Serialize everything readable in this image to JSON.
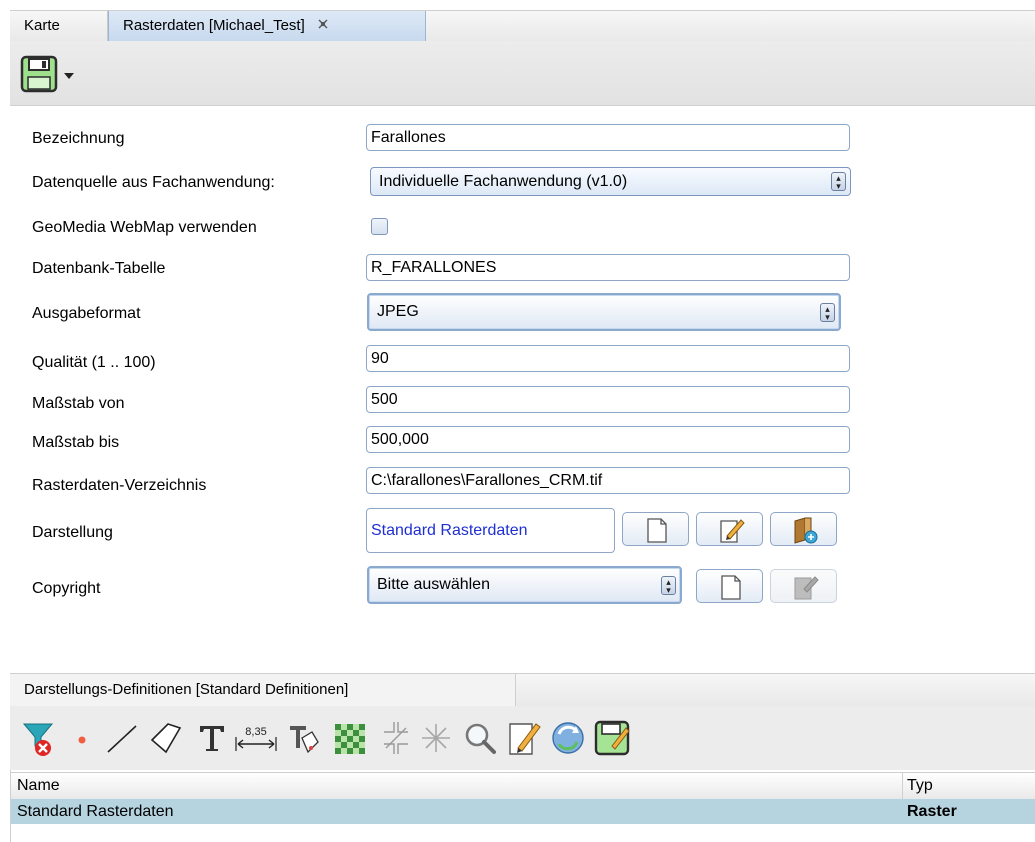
{
  "tabs": {
    "map": "Karte",
    "raster": "Rasterdaten [Michael_Test]",
    "close_icon": "close-icon"
  },
  "toolbar": {
    "save_icon": "floppy-disk-icon"
  },
  "form": {
    "bezeichnung": {
      "label": "Bezeichnung",
      "value": "Farallones"
    },
    "datenquelle": {
      "label": "Datenquelle aus Fachanwendung:",
      "value": "Individuelle Fachanwendung (v1.0)"
    },
    "webmap": {
      "label": "GeoMedia WebMap verwenden",
      "checked": false
    },
    "tabelle": {
      "label": "Datenbank-Tabelle",
      "value": "R_FARALLONES"
    },
    "ausgabeformat": {
      "label": "Ausgabeformat",
      "value": "JPEG"
    },
    "qualitaet": {
      "label": "Qualität (1 .. 100)",
      "value": "90"
    },
    "massstab_von": {
      "label": "Maßstab von",
      "value": "500"
    },
    "massstab_bis": {
      "label": "Maßstab bis",
      "value": "500,000"
    },
    "verzeichnis": {
      "label": "Rasterdaten-Verzeichnis",
      "value": "C:\\farallones\\Farallones_CRM.tif"
    },
    "darstellung": {
      "label": "Darstellung",
      "value": "Standard Rasterdaten",
      "value_color": "#1f2fd1"
    },
    "copyright": {
      "label": "Copyright",
      "value": "Bitte auswählen"
    }
  },
  "bottom": {
    "tab": "Darstellungs-Definitionen [Standard Definitionen]",
    "dimension_text": "8,35",
    "columns": {
      "name": "Name",
      "type": "Typ"
    },
    "rows": [
      {
        "name": "Standard Rasterdaten",
        "type": "Raster"
      }
    ]
  },
  "colors": {
    "selected_row": "#b6d3e0",
    "link_text": "#1f2fd1"
  }
}
